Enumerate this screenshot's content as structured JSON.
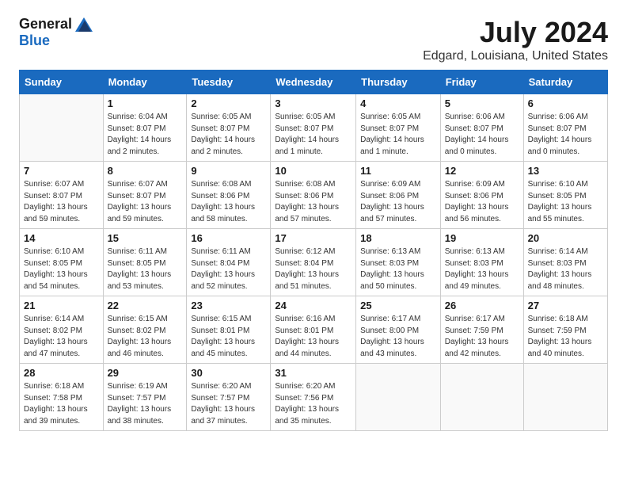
{
  "logo": {
    "general": "General",
    "blue": "Blue"
  },
  "title": "July 2024",
  "location": "Edgard, Louisiana, United States",
  "days_of_week": [
    "Sunday",
    "Monday",
    "Tuesday",
    "Wednesday",
    "Thursday",
    "Friday",
    "Saturday"
  ],
  "weeks": [
    [
      {
        "day": "",
        "info": ""
      },
      {
        "day": "1",
        "info": "Sunrise: 6:04 AM\nSunset: 8:07 PM\nDaylight: 14 hours\nand 2 minutes."
      },
      {
        "day": "2",
        "info": "Sunrise: 6:05 AM\nSunset: 8:07 PM\nDaylight: 14 hours\nand 2 minutes."
      },
      {
        "day": "3",
        "info": "Sunrise: 6:05 AM\nSunset: 8:07 PM\nDaylight: 14 hours\nand 1 minute."
      },
      {
        "day": "4",
        "info": "Sunrise: 6:05 AM\nSunset: 8:07 PM\nDaylight: 14 hours\nand 1 minute."
      },
      {
        "day": "5",
        "info": "Sunrise: 6:06 AM\nSunset: 8:07 PM\nDaylight: 14 hours\nand 0 minutes."
      },
      {
        "day": "6",
        "info": "Sunrise: 6:06 AM\nSunset: 8:07 PM\nDaylight: 14 hours\nand 0 minutes."
      }
    ],
    [
      {
        "day": "7",
        "info": "Sunrise: 6:07 AM\nSunset: 8:07 PM\nDaylight: 13 hours\nand 59 minutes."
      },
      {
        "day": "8",
        "info": "Sunrise: 6:07 AM\nSunset: 8:07 PM\nDaylight: 13 hours\nand 59 minutes."
      },
      {
        "day": "9",
        "info": "Sunrise: 6:08 AM\nSunset: 8:06 PM\nDaylight: 13 hours\nand 58 minutes."
      },
      {
        "day": "10",
        "info": "Sunrise: 6:08 AM\nSunset: 8:06 PM\nDaylight: 13 hours\nand 57 minutes."
      },
      {
        "day": "11",
        "info": "Sunrise: 6:09 AM\nSunset: 8:06 PM\nDaylight: 13 hours\nand 57 minutes."
      },
      {
        "day": "12",
        "info": "Sunrise: 6:09 AM\nSunset: 8:06 PM\nDaylight: 13 hours\nand 56 minutes."
      },
      {
        "day": "13",
        "info": "Sunrise: 6:10 AM\nSunset: 8:05 PM\nDaylight: 13 hours\nand 55 minutes."
      }
    ],
    [
      {
        "day": "14",
        "info": "Sunrise: 6:10 AM\nSunset: 8:05 PM\nDaylight: 13 hours\nand 54 minutes."
      },
      {
        "day": "15",
        "info": "Sunrise: 6:11 AM\nSunset: 8:05 PM\nDaylight: 13 hours\nand 53 minutes."
      },
      {
        "day": "16",
        "info": "Sunrise: 6:11 AM\nSunset: 8:04 PM\nDaylight: 13 hours\nand 52 minutes."
      },
      {
        "day": "17",
        "info": "Sunrise: 6:12 AM\nSunset: 8:04 PM\nDaylight: 13 hours\nand 51 minutes."
      },
      {
        "day": "18",
        "info": "Sunrise: 6:13 AM\nSunset: 8:03 PM\nDaylight: 13 hours\nand 50 minutes."
      },
      {
        "day": "19",
        "info": "Sunrise: 6:13 AM\nSunset: 8:03 PM\nDaylight: 13 hours\nand 49 minutes."
      },
      {
        "day": "20",
        "info": "Sunrise: 6:14 AM\nSunset: 8:03 PM\nDaylight: 13 hours\nand 48 minutes."
      }
    ],
    [
      {
        "day": "21",
        "info": "Sunrise: 6:14 AM\nSunset: 8:02 PM\nDaylight: 13 hours\nand 47 minutes."
      },
      {
        "day": "22",
        "info": "Sunrise: 6:15 AM\nSunset: 8:02 PM\nDaylight: 13 hours\nand 46 minutes."
      },
      {
        "day": "23",
        "info": "Sunrise: 6:15 AM\nSunset: 8:01 PM\nDaylight: 13 hours\nand 45 minutes."
      },
      {
        "day": "24",
        "info": "Sunrise: 6:16 AM\nSunset: 8:01 PM\nDaylight: 13 hours\nand 44 minutes."
      },
      {
        "day": "25",
        "info": "Sunrise: 6:17 AM\nSunset: 8:00 PM\nDaylight: 13 hours\nand 43 minutes."
      },
      {
        "day": "26",
        "info": "Sunrise: 6:17 AM\nSunset: 7:59 PM\nDaylight: 13 hours\nand 42 minutes."
      },
      {
        "day": "27",
        "info": "Sunrise: 6:18 AM\nSunset: 7:59 PM\nDaylight: 13 hours\nand 40 minutes."
      }
    ],
    [
      {
        "day": "28",
        "info": "Sunrise: 6:18 AM\nSunset: 7:58 PM\nDaylight: 13 hours\nand 39 minutes."
      },
      {
        "day": "29",
        "info": "Sunrise: 6:19 AM\nSunset: 7:57 PM\nDaylight: 13 hours\nand 38 minutes."
      },
      {
        "day": "30",
        "info": "Sunrise: 6:20 AM\nSunset: 7:57 PM\nDaylight: 13 hours\nand 37 minutes."
      },
      {
        "day": "31",
        "info": "Sunrise: 6:20 AM\nSunset: 7:56 PM\nDaylight: 13 hours\nand 35 minutes."
      },
      {
        "day": "",
        "info": ""
      },
      {
        "day": "",
        "info": ""
      },
      {
        "day": "",
        "info": ""
      }
    ]
  ]
}
